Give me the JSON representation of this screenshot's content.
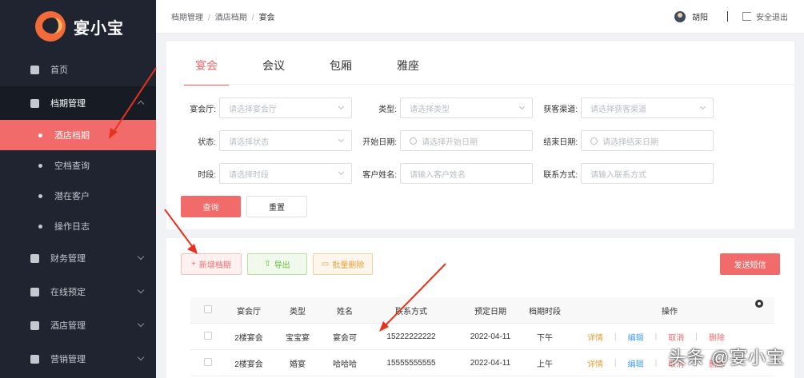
{
  "sidebar": {
    "brand": "宴小宝",
    "items": [
      {
        "label": "首页"
      },
      {
        "label": "档期管理"
      },
      {
        "label": "财务管理"
      },
      {
        "label": "在线预定"
      },
      {
        "label": "酒店管理"
      },
      {
        "label": "营销管理"
      }
    ],
    "subitems": [
      {
        "label": "酒店档期"
      },
      {
        "label": "空档查询"
      },
      {
        "label": "潜在客户"
      },
      {
        "label": "操作日志"
      }
    ]
  },
  "header": {
    "breadcrumb": [
      "档期管理",
      "酒店档期",
      "宴会"
    ],
    "user": "胡阳",
    "logout": "安全退出"
  },
  "tabs": [
    "宴会",
    "会议",
    "包厢",
    "雅座"
  ],
  "filters": {
    "hall": {
      "label": "宴会厅:",
      "placeholder": "请选择宴会厅"
    },
    "type": {
      "label": "类型:",
      "placeholder": "请选择类型"
    },
    "channel": {
      "label": "获客渠道:",
      "placeholder": "请选择获客渠道"
    },
    "status": {
      "label": "状态:",
      "placeholder": "请选择状态"
    },
    "start": {
      "label": "开始日期:",
      "placeholder": "请选择开始日期"
    },
    "end": {
      "label": "结束日期:",
      "placeholder": "请选择结束日期"
    },
    "period": {
      "label": "时段:",
      "placeholder": "请选择时段"
    },
    "name": {
      "label": "客户姓名:",
      "placeholder": "请输入客户姓名"
    },
    "contact": {
      "label": "联系方式:",
      "placeholder": "请输入联系方式"
    }
  },
  "buttons": {
    "query": "查询",
    "reset": "重置",
    "add": "新增档期",
    "export": "导出",
    "batch_delete": "批量删除",
    "sms": "发送短信"
  },
  "table": {
    "headers": [
      "宴会厅",
      "类型",
      "姓名",
      "联系方式",
      "预定日期",
      "档期时段",
      "操作"
    ],
    "rows": [
      {
        "hall": "2楼宴会",
        "type": "宝宝宴",
        "name": "宴会可",
        "phone": "15222222222",
        "date": "2022-04-11",
        "period": "下午"
      },
      {
        "hall": "2楼宴会",
        "type": "婚宴",
        "name": "哈哈哈",
        "phone": "15555555555",
        "date": "2022-04-11",
        "period": "上午"
      }
    ],
    "ops": {
      "detail": "详情",
      "edit": "编辑",
      "cancel": "取消",
      "delete": "删除"
    }
  },
  "watermark": "头条 @宴小宝",
  "colors": {
    "accent": "#f26b6b",
    "sidebar": "#1f2430",
    "arrow": "#e8321e"
  }
}
